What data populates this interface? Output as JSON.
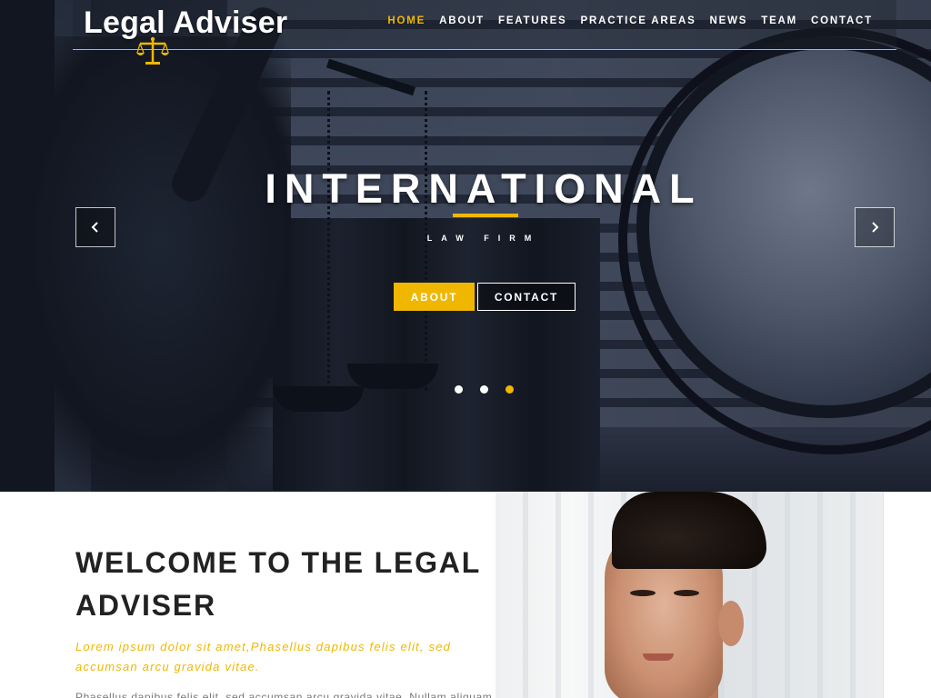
{
  "brand": {
    "name": "Legal Adviser"
  },
  "nav": {
    "items": [
      {
        "label": "HOME",
        "active": true
      },
      {
        "label": "ABOUT"
      },
      {
        "label": "FEATURES"
      },
      {
        "label": "PRACTICE AREAS"
      },
      {
        "label": "NEWS"
      },
      {
        "label": "TEAM"
      },
      {
        "label": "CONTACT"
      }
    ]
  },
  "hero": {
    "title": "INTERNATIONAL",
    "subtitle": "LAW FIRM",
    "primary_button": "ABOUT",
    "secondary_button": "CONTACT",
    "prev_icon": "chevron-left-icon",
    "next_icon": "chevron-right-icon",
    "slides": 3,
    "active_slide": 3
  },
  "welcome": {
    "title": "WELCOME TO THE LEGAL ADVISER",
    "lead": "Lorem ipsum dolor sit amet,Phasellus dapibus felis elit, sed accumsan arcu gravida vitae.",
    "body": "Phasellus dapibus felis elit, sed accumsan arcu gravida vitae. Nullam aliquam"
  },
  "colors": {
    "accent": "#f0b700",
    "heading": "#222222",
    "body_text": "#777777"
  }
}
